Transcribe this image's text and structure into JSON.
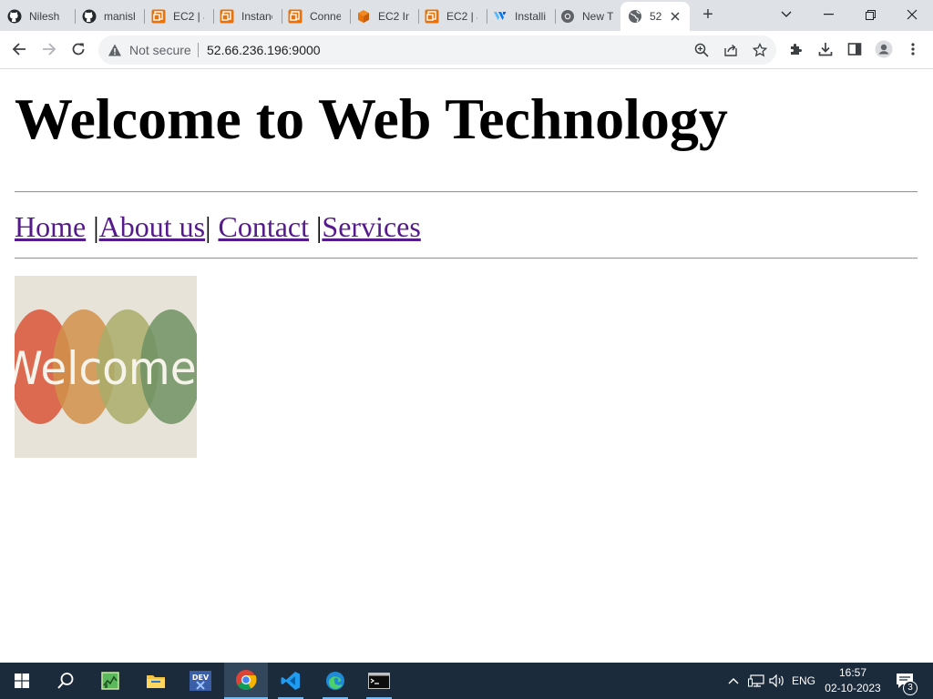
{
  "browser": {
    "tabs": [
      {
        "title": "Nilesh",
        "icon": "github-icon"
      },
      {
        "title": "manish",
        "icon": "github-icon"
      },
      {
        "title": "EC2 | a",
        "icon": "aws-icon"
      },
      {
        "title": "Instanc",
        "icon": "aws-icon"
      },
      {
        "title": "Conne",
        "icon": "aws-icon"
      },
      {
        "title": "EC2 In",
        "icon": "aws-cube-icon"
      },
      {
        "title": "EC2 | a",
        "icon": "aws-icon"
      },
      {
        "title": "Installi",
        "icon": "vultr-icon"
      },
      {
        "title": "New T",
        "icon": "chrome-icon"
      },
      {
        "title": "52",
        "icon": "globe-icon",
        "active": true
      }
    ],
    "new_tab_label": "+",
    "address": {
      "security_label": "Not secure",
      "url": "52.66.236.196:9000"
    }
  },
  "page": {
    "heading": "Welcome to Web Technology",
    "nav": {
      "links": [
        "Home",
        "About us",
        "Contact",
        "Services"
      ],
      "separator": "|"
    },
    "image_text": "Welcome"
  },
  "taskbar": {
    "apps": [
      "windows-start-icon",
      "search-icon",
      "task-manager-icon",
      "file-explorer-icon",
      "dev-icon",
      "chrome-icon",
      "vscode-icon",
      "edge-icon",
      "terminal-icon"
    ],
    "language": "ENG",
    "time": "16:57",
    "date": "02-10-2023",
    "notification_count": "3"
  },
  "colors": {
    "tabstrip_bg": "#dee1e6",
    "visited_link": "#551a8b",
    "taskbar_bg": "#1c2b3b",
    "aws_orange": "#e8720c"
  }
}
